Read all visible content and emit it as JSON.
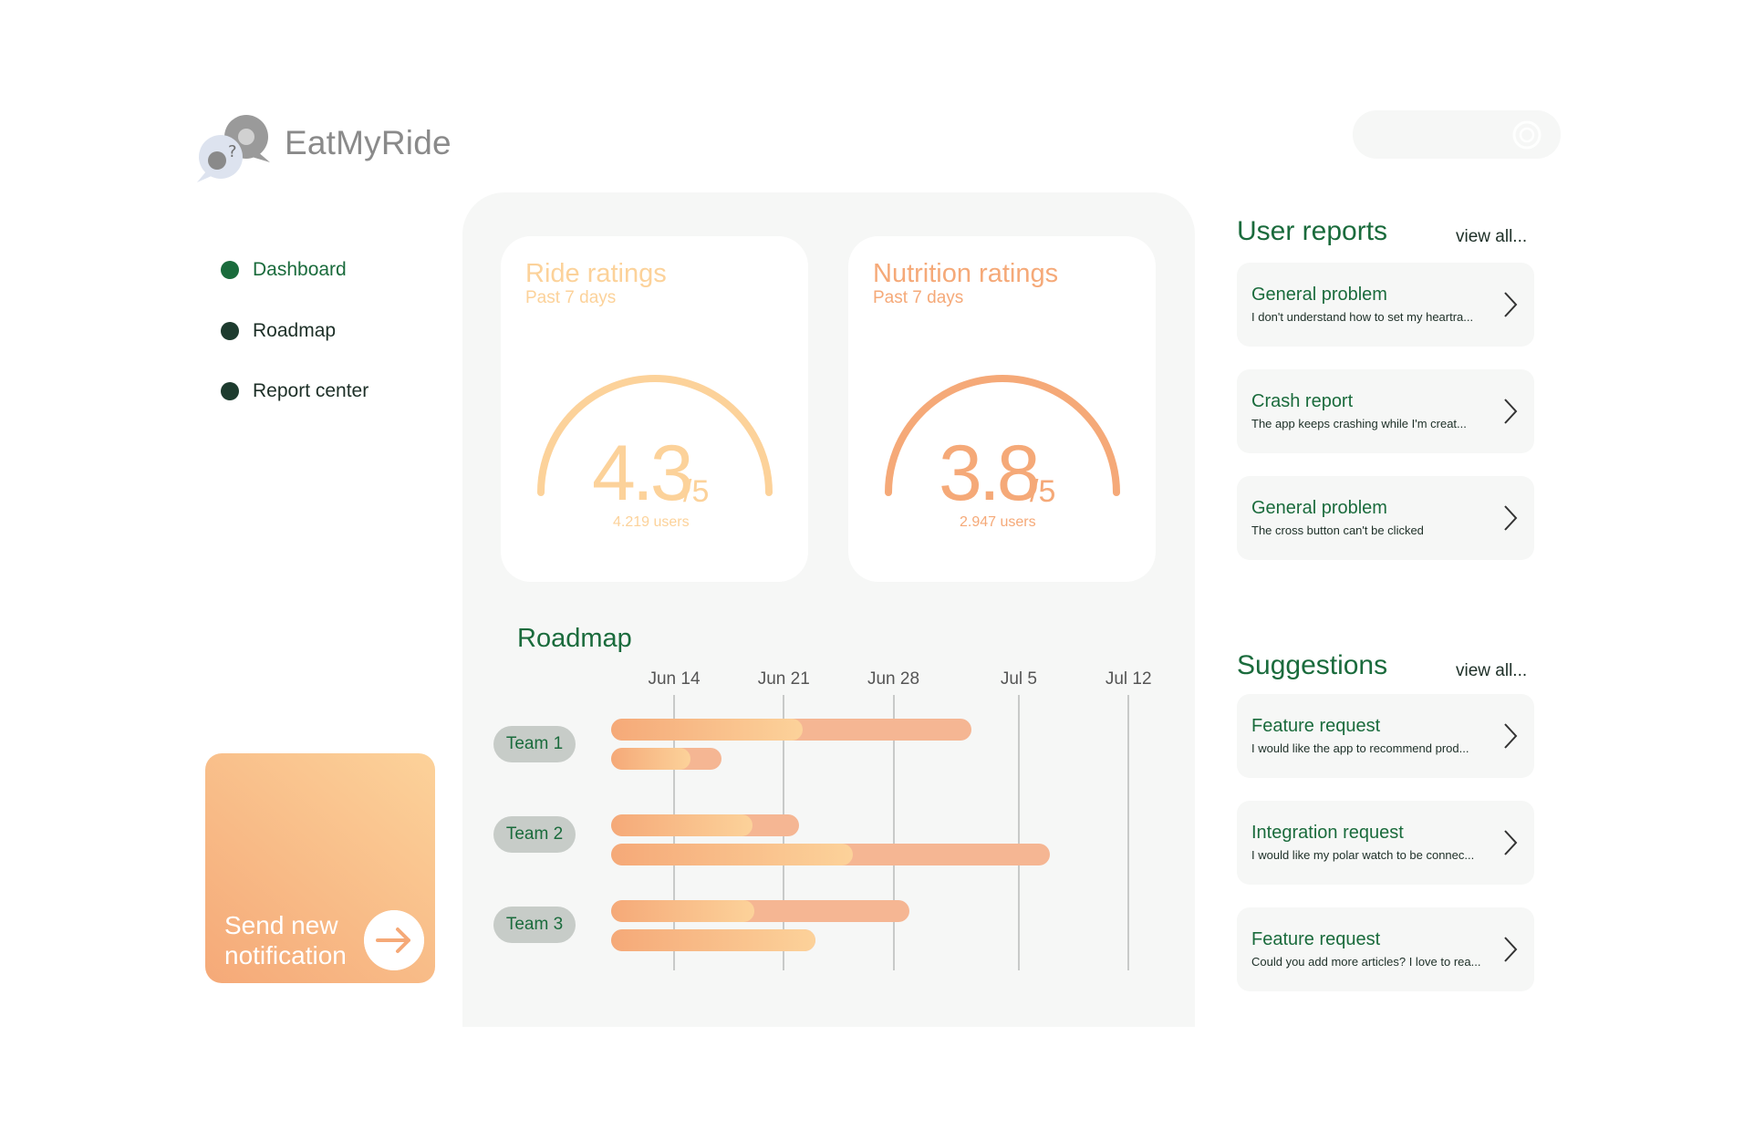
{
  "app": {
    "name": "EatMyRide"
  },
  "colors": {
    "accent_green": "#1a6b3c",
    "peach": "#f5a978",
    "light_orange": "#fcd29a",
    "panel_bg": "#f6f7f6"
  },
  "search": {
    "icon": "search-icon"
  },
  "nav": {
    "items": [
      {
        "label": "Dashboard",
        "active": true
      },
      {
        "label": "Roadmap",
        "active": false
      },
      {
        "label": "Report center",
        "active": false
      }
    ]
  },
  "send_notification": {
    "label": "Send new notification",
    "icon": "arrow-right-icon"
  },
  "ratings": [
    {
      "title": "Ride ratings",
      "subtitle": "Past 7 days",
      "value": "4.3",
      "denominator": "/5",
      "users": "4.219 users",
      "score": 4.3,
      "max": 5
    },
    {
      "title": "Nutrition ratings",
      "subtitle": "Past 7 days",
      "value": "3.8",
      "denominator": "/5",
      "users": "2.947 users",
      "score": 3.8,
      "max": 5
    }
  ],
  "roadmap": {
    "title": "Roadmap",
    "dates": [
      "Jun 14",
      "Jun 21",
      "Jun 28",
      "Jul 5",
      "Jul 12"
    ],
    "teams": [
      {
        "label": "Team 1",
        "bars": [
          {
            "start": "Jun 10",
            "end": "Jul 2",
            "progress": 0.53
          },
          {
            "start": "Jun 10",
            "end": "Jun 17",
            "progress": 0.72
          }
        ]
      },
      {
        "label": "Team 2",
        "bars": [
          {
            "start": "Jun 10",
            "end": "Jun 22",
            "progress": 0.75
          },
          {
            "start": "Jun 10",
            "end": "Jul 7",
            "progress": 0.55
          }
        ]
      },
      {
        "label": "Team 3",
        "bars": [
          {
            "start": "Jun 10",
            "end": "Jun 29",
            "progress": 0.48
          },
          {
            "start": "Jun 10",
            "end": "Jun 23",
            "progress": 1.0
          }
        ]
      }
    ]
  },
  "user_reports": {
    "title": "User reports",
    "view_all": "view all...",
    "items": [
      {
        "title": "General problem",
        "desc": "I don't understand how to set my heartra..."
      },
      {
        "title": "Crash report",
        "desc": "The app keeps crashing while I'm creat..."
      },
      {
        "title": "General problem",
        "desc": "The cross button can't be clicked"
      }
    ]
  },
  "suggestions": {
    "title": "Suggestions",
    "view_all": "view all...",
    "items": [
      {
        "title": "Feature request",
        "desc": "I would like the app to recommend prod..."
      },
      {
        "title": "Integration request",
        "desc": "I would like my polar watch to be connec..."
      },
      {
        "title": "Feature request",
        "desc": "Could you add more articles? I love to rea..."
      }
    ]
  }
}
